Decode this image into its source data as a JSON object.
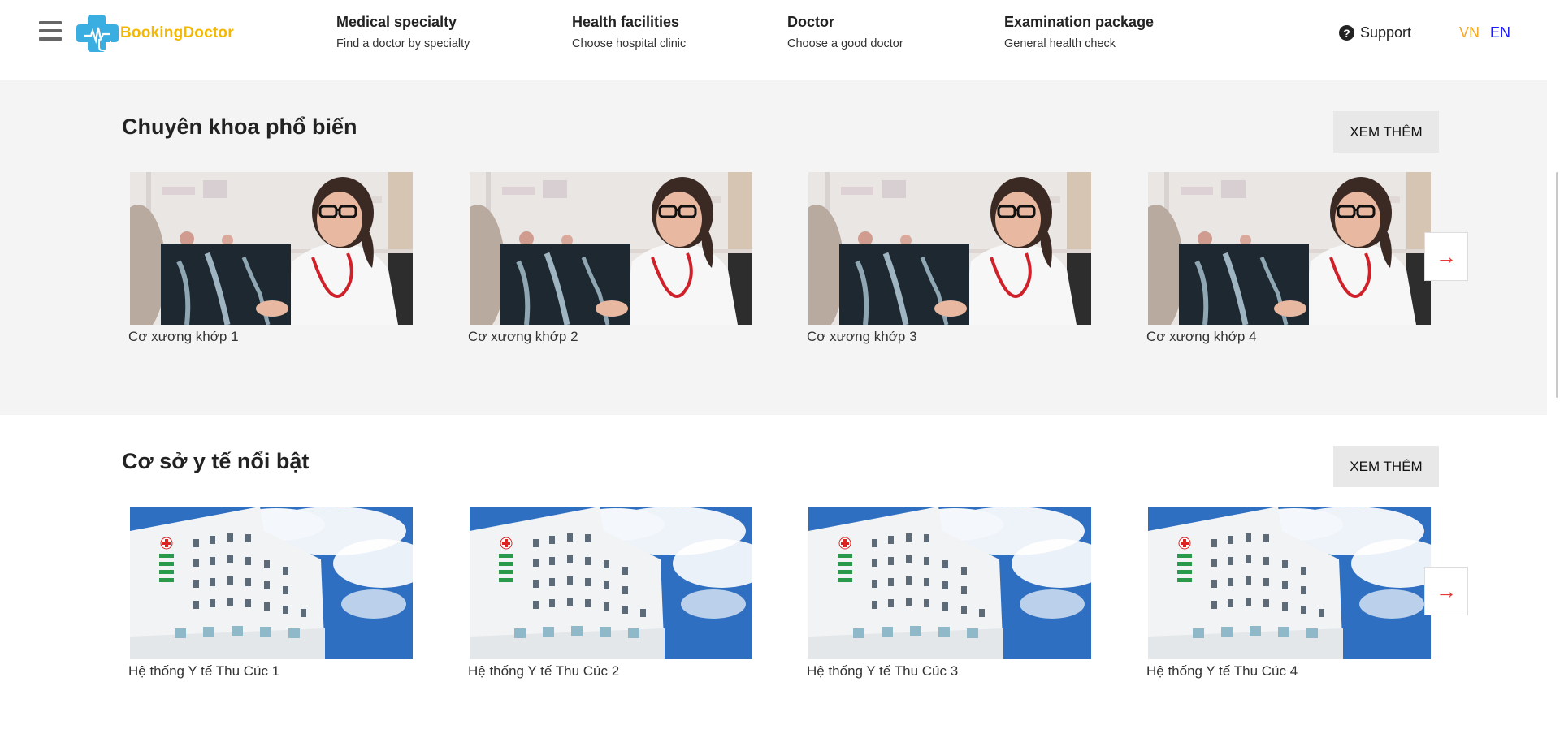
{
  "header": {
    "logo_text": "BookingDoctor",
    "nav": [
      {
        "title": "Medical specialty",
        "subtitle": "Find a doctor by specialty"
      },
      {
        "title": "Health facilities",
        "subtitle": "Choose hospital clinic"
      },
      {
        "title": "Doctor",
        "subtitle": "Choose a good doctor"
      },
      {
        "title": "Examination package",
        "subtitle": "General health check"
      }
    ],
    "support_label": "Support",
    "support_icon": "?",
    "lang_vn": "VN",
    "lang_en": "EN"
  },
  "sections": [
    {
      "title": "Chuyên khoa phổ biến",
      "more_label": "XEM THÊM",
      "items": [
        {
          "label": "Cơ xương khớp 1"
        },
        {
          "label": "Cơ xương khớp 2"
        },
        {
          "label": "Cơ xương khớp 3"
        },
        {
          "label": "Cơ xương khớp 4"
        }
      ],
      "next_label": "→"
    },
    {
      "title": "Cơ sở y tế nổi bật",
      "more_label": "XEM THÊM",
      "items": [
        {
          "label": "Hệ thống Y tế Thu Cúc 1"
        },
        {
          "label": "Hệ thống Y tế Thu Cúc 2"
        },
        {
          "label": "Hệ thống Y tế Thu Cúc 3"
        },
        {
          "label": "Hệ thống Y tế Thu Cúc 4"
        }
      ],
      "next_label": "→"
    }
  ],
  "colors": {
    "logo_yellow": "#f5b800",
    "logo_blue": "#3aaee0",
    "lang_vn": "#f5a623",
    "lang_en": "#1a1aff",
    "next_arrow": "#e53935",
    "section_bg": "#f4f4f4"
  }
}
